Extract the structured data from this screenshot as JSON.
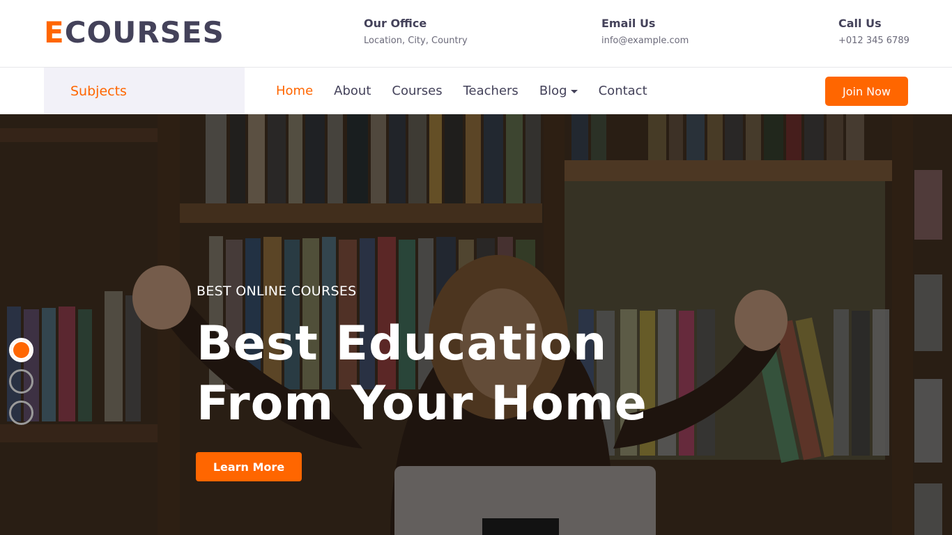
{
  "brand": {
    "logo_first": "E",
    "logo_rest": "COURSES"
  },
  "header": {
    "office_label": "Our Office",
    "office_value": "Location, City, Country",
    "email_label": "Email Us",
    "email_value": "info@example.com",
    "call_label": "Call Us",
    "call_value": "+012 345 6789"
  },
  "nav": {
    "subjects": "Subjects",
    "links": [
      "Home",
      "About",
      "Courses",
      "Teachers",
      "Blog",
      "Contact"
    ],
    "active": "Home",
    "join": "Join Now"
  },
  "hero": {
    "kicker": "BEST ONLINE COURSES",
    "title_line1": "Best Education",
    "title_line2": "From Your Home",
    "cta": "Learn More",
    "slides": 3,
    "active_slide": 1
  },
  "colors": {
    "accent": "#ff6600",
    "dark": "#44425a",
    "subjects_bg": "#f2f1f8"
  }
}
